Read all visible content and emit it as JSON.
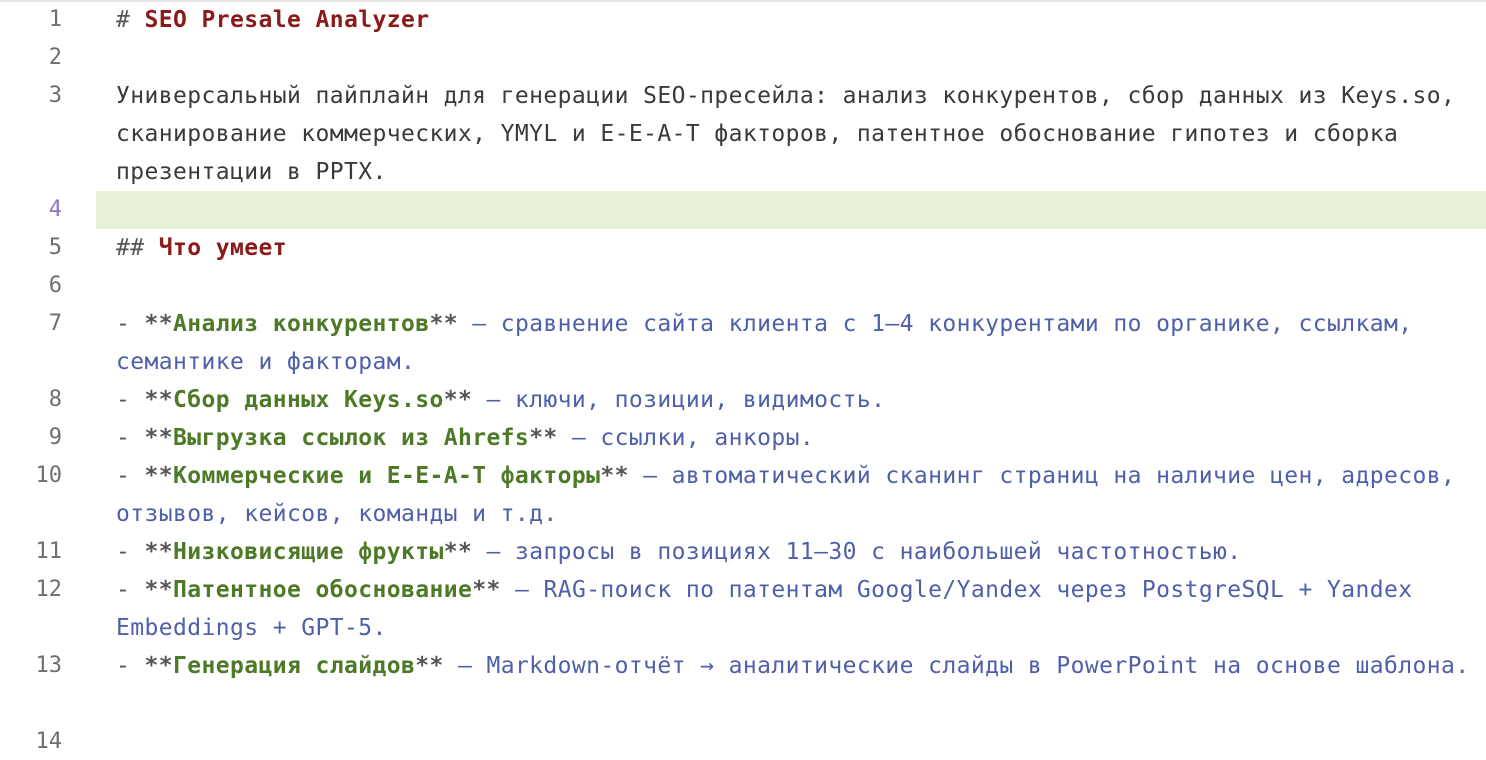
{
  "lines": [
    {
      "num": "1",
      "prefix": "# ",
      "text": "SEO Presale Analyzer"
    },
    {
      "num": "2"
    },
    {
      "num": "3",
      "text": "Универсальный пайплайн для генерации SEO-пресейла: анализ конкурентов, сбор данных из Keys.so, сканирование коммерческих, YMYL и E-E-A-T факторов, патентное обоснование гипотез и сборка презентации в PPTX."
    },
    {
      "num": "4"
    },
    {
      "num": "5",
      "prefix": "## ",
      "text": "Что умеет"
    },
    {
      "num": "6"
    },
    {
      "num": "7",
      "dash": "- ",
      "stars_open": "**",
      "bold": "Анализ конкурентов",
      "stars_close": "**",
      "desc": " — сравнение сайта клиента с 1–4 конкурентами по органике, ссылкам, семантике и факторам."
    },
    {
      "num": "8",
      "dash": "- ",
      "stars_open": "**",
      "bold": "Сбор данных Keys.so",
      "stars_close": "**",
      "desc": " — ключи, позиции, видимость."
    },
    {
      "num": "9",
      "dash": "- ",
      "stars_open": "**",
      "bold": "Выгрузка ссылок из Ahrefs",
      "stars_close": "**",
      "desc": " — ссылки, анкоры."
    },
    {
      "num": "10",
      "dash": "- ",
      "stars_open": "**",
      "bold": "Коммерческие и E-E-A-T факторы",
      "stars_close": "**",
      "desc": " — автоматический сканинг страниц на наличие цен, адресов, отзывов, кейсов, команды и т.д."
    },
    {
      "num": "11",
      "dash": "- ",
      "stars_open": "**",
      "bold": "Низковисящие фрукты",
      "stars_close": "**",
      "desc": " — запросы в позициях 11–30 с наибольшей частотностью."
    },
    {
      "num": "12",
      "dash": "- ",
      "stars_open": "**",
      "bold": "Патентное обоснование",
      "stars_close": "**",
      "desc": " — RAG-поиск по патентам Google/Yandex через PostgreSQL + Yandex Embeddings + GPT-5."
    },
    {
      "num": "13",
      "dash": "- ",
      "stars_open": "**",
      "bold": "Генерация слайдов",
      "stars_close": "**",
      "desc": " — Markdown-отчёт → аналитические слайды в PowerPoint на основе шаблона."
    },
    {
      "num": "14"
    }
  ],
  "current_line": "4",
  "colors": {
    "heading": "#8b1a1a",
    "bold_text": "#4e7a28",
    "description": "#4f5fa8",
    "current_line_bg": "#e8f2d9",
    "current_line_number": "#8a73c9"
  }
}
